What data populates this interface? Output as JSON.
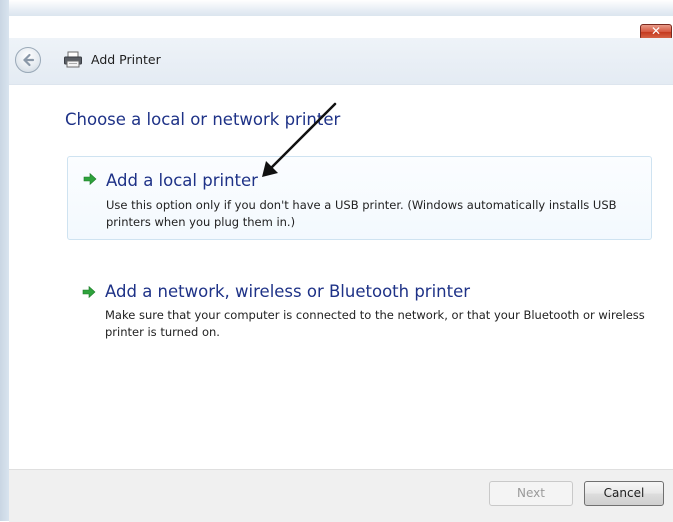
{
  "window": {
    "title": "Add Printer",
    "close_glyph": "✕"
  },
  "content": {
    "heading": "Choose a local or network printer",
    "options": [
      {
        "title": "Add a local printer",
        "description": "Use this option only if you don't have a USB printer. (Windows automatically installs USB printers when you plug them in.)",
        "icon": "green-arrow-icon"
      },
      {
        "title": "Add a network, wireless or Bluetooth printer",
        "description": "Make sure that your computer is connected to the network, or that your Bluetooth or wireless printer is turned on.",
        "icon": "green-arrow-icon"
      }
    ]
  },
  "footer": {
    "next_label": "Next",
    "cancel_label": "Cancel"
  },
  "colors": {
    "heading": "#1e3287",
    "arrow": "#2ea33c",
    "close": "#c43a1f"
  }
}
